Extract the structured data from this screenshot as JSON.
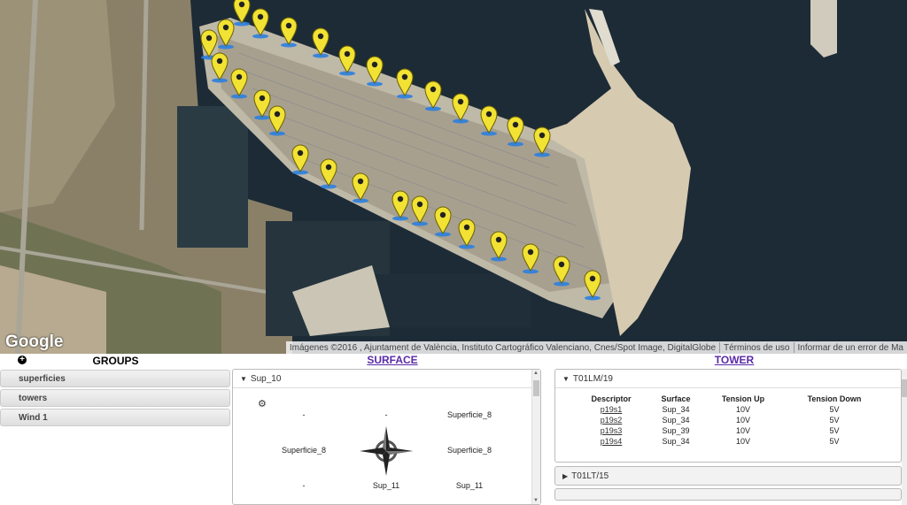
{
  "map": {
    "google_logo": "Google",
    "attribution": "Imágenes ©2016 , Ajuntament de València, Instituto Cartográfico Valenciano, Cnes/Spot Image, DigitalGlobe",
    "terms": "Términos de uso",
    "report": "Informar de un error de Ma",
    "marker_count": 33,
    "colors": {
      "marker": "#f2e233",
      "sea": "#1b2a33",
      "port": "#bcb6a6"
    }
  },
  "groups": {
    "title": "GROUPS",
    "add_icon": "plus-circle-icon",
    "items": [
      "superficies",
      "towers",
      "Wind 1"
    ]
  },
  "surface": {
    "title": "SURFACE",
    "section": "Sup_10",
    "grid": {
      "r1": [
        "-",
        "-",
        "Superficie_8"
      ],
      "r2": [
        "Superficie_8",
        "Superficie_8"
      ],
      "r3": [
        "-",
        "Sup_11",
        "Sup_11"
      ]
    }
  },
  "tower": {
    "title": "TOWER",
    "section": "T01LM/19",
    "section2": "T01LT/15",
    "headers": [
      "Descriptor",
      "Surface",
      "Tension Up",
      "Tension Down"
    ],
    "rows": [
      [
        "p19s1",
        "Sup_34",
        "10V",
        "5V"
      ],
      [
        "p19s2",
        "Sup_34",
        "10V",
        "5V"
      ],
      [
        "p19s3",
        "Sup_39",
        "10V",
        "5V"
      ],
      [
        "p19s4",
        "Sup_34",
        "10V",
        "5V"
      ]
    ]
  }
}
